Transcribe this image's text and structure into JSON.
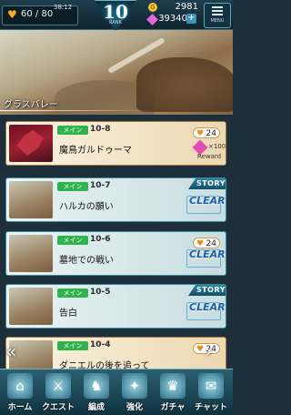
{
  "header": {
    "stamina": "60 / 80",
    "stamina_timer": "38:12",
    "rank": "10",
    "rank_label": "RANK",
    "coins": "2981",
    "gems": "39340",
    "plus": "+",
    "menu_label": "MENU"
  },
  "banner": {
    "area_name": "グラスバレー"
  },
  "quests": [
    {
      "tag": "メイン",
      "number": "10-8",
      "title": "魔鳥ガルドゥーマ",
      "cost": "24",
      "reward_count": "100",
      "reward_label": "Reward",
      "cleared": false,
      "story": false
    },
    {
      "tag": "メイン",
      "number": "10-7",
      "title": "ハルカの願い",
      "cleared": true,
      "story": true,
      "clear_label": "CLEAR",
      "story_label": "STORY"
    },
    {
      "tag": "メイン",
      "number": "10-6",
      "title": "墓地での戦い",
      "cost": "24",
      "cleared": true,
      "story": false,
      "clear_label": "CLEAR"
    },
    {
      "tag": "メイン",
      "number": "10-5",
      "title": "告白",
      "cleared": true,
      "story": true,
      "clear_label": "CLEAR",
      "story_label": "STORY"
    },
    {
      "tag": "メイン",
      "number": "10-4",
      "title": "ダニエルの後を追って",
      "cost": "24",
      "cleared": false,
      "story": false
    }
  ],
  "bottom_nav": [
    {
      "label": "ホーム",
      "icon": "home-icon"
    },
    {
      "label": "クエスト",
      "icon": "quest-icon"
    },
    {
      "label": "編成",
      "icon": "formation-icon"
    },
    {
      "label": "強化",
      "icon": "enhance-icon"
    },
    {
      "label": "ガチャ",
      "icon": "gacha-icon"
    },
    {
      "label": "チャット",
      "icon": "chat-icon"
    }
  ]
}
